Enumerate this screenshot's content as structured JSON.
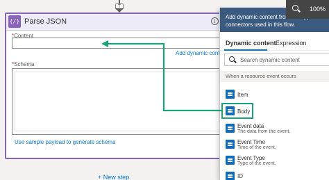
{
  "window": {
    "zoom_level": "100%"
  },
  "flow": {
    "connector_badge": "T",
    "card": {
      "icon_text": "{/}",
      "title": "Parse JSON",
      "content_label": "Content",
      "required_mark": "*",
      "dynamic_link": "Add dynamic content",
      "schema_label": "Schema",
      "sample_link": "Use sample payload to generate schema"
    },
    "new_step": "+ New step"
  },
  "panel": {
    "header_text": "Add dynamic content from the apps and connectors used in this flow.",
    "tabs": [
      {
        "label": "Dynamic content",
        "active": true
      },
      {
        "label": "Expression",
        "active": false
      }
    ],
    "search_placeholder": "Search dynamic content",
    "section_title": "When a resource event occurs",
    "items": [
      {
        "name": "Item",
        "description": ""
      },
      {
        "name": "Body",
        "description": ""
      },
      {
        "name": "Event data",
        "description": "The data from the event."
      },
      {
        "name": "Event Time",
        "description": "Time of the event."
      },
      {
        "name": "Event Type",
        "description": "Type of the event."
      },
      {
        "name": "ID",
        "description": ""
      }
    ]
  },
  "colors": {
    "accent": "#8764b8",
    "link": "#0078d4",
    "panel_header": "#3a5a7f",
    "annotation": "#1aa37a"
  },
  "icons": {
    "zoom": "magnifier-icon",
    "search": "search-icon",
    "info": "info-icon",
    "item": "dynamic-content-icon"
  }
}
